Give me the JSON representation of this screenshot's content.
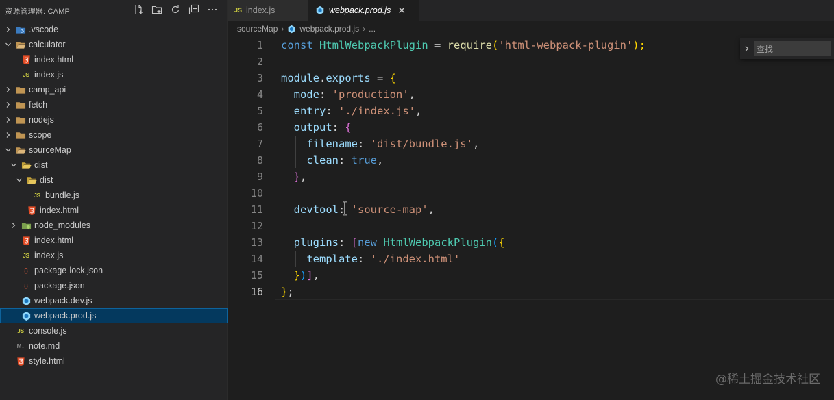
{
  "sidebar": {
    "title": "资源管理器: CAMP",
    "actions": [
      "new-file-icon",
      "new-folder-icon",
      "refresh-icon",
      "collapse-all-icon",
      "more-icon"
    ],
    "items": [
      {
        "label": ".vscode",
        "level": 0,
        "type": "folder",
        "expanded": false,
        "icon": "vscode-folder-icon"
      },
      {
        "label": "calculator",
        "level": 0,
        "type": "folder",
        "expanded": true,
        "icon": "folder-open-icon"
      },
      {
        "label": "index.html",
        "level": 1,
        "type": "file",
        "icon": "html-icon"
      },
      {
        "label": "index.js",
        "level": 1,
        "type": "file",
        "icon": "js-icon"
      },
      {
        "label": "camp_api",
        "level": 0,
        "type": "folder",
        "expanded": false,
        "icon": "folder-icon"
      },
      {
        "label": "fetch",
        "level": 0,
        "type": "folder",
        "expanded": false,
        "icon": "folder-icon"
      },
      {
        "label": "nodejs",
        "level": 0,
        "type": "folder",
        "expanded": false,
        "icon": "folder-icon"
      },
      {
        "label": "scope",
        "level": 0,
        "type": "folder",
        "expanded": false,
        "icon": "folder-icon"
      },
      {
        "label": "sourceMap",
        "level": 0,
        "type": "folder",
        "expanded": true,
        "icon": "folder-open-icon"
      },
      {
        "label": "dist",
        "level": 1,
        "type": "folder",
        "expanded": true,
        "icon": "dist-folder-icon"
      },
      {
        "label": "dist",
        "level": 2,
        "type": "folder",
        "expanded": true,
        "icon": "dist-folder-icon"
      },
      {
        "label": "bundle.js",
        "level": 3,
        "type": "file",
        "icon": "js-icon"
      },
      {
        "label": "index.html",
        "level": 2,
        "type": "file",
        "icon": "html-icon"
      },
      {
        "label": "node_modules",
        "level": 1,
        "type": "folder",
        "expanded": false,
        "icon": "node-folder-icon"
      },
      {
        "label": "index.html",
        "level": 1,
        "type": "file",
        "icon": "html-icon"
      },
      {
        "label": "index.js",
        "level": 1,
        "type": "file",
        "icon": "js-icon"
      },
      {
        "label": "package-lock.json",
        "level": 1,
        "type": "file",
        "icon": "json-icon"
      },
      {
        "label": "package.json",
        "level": 1,
        "type": "file",
        "icon": "json-icon"
      },
      {
        "label": "webpack.dev.js",
        "level": 1,
        "type": "file",
        "icon": "webpack-icon"
      },
      {
        "label": "webpack.prod.js",
        "level": 1,
        "type": "file",
        "icon": "webpack-icon",
        "selected": true
      },
      {
        "label": "console.js",
        "level": 0,
        "type": "file",
        "icon": "js-icon"
      },
      {
        "label": "note.md",
        "level": 0,
        "type": "file",
        "icon": "markdown-icon"
      },
      {
        "label": "style.html",
        "level": 0,
        "type": "file",
        "icon": "html-icon"
      }
    ]
  },
  "tabs": [
    {
      "label": "index.js",
      "icon": "js-icon",
      "active": false,
      "js_badge": "JS"
    },
    {
      "label": "webpack.prod.js",
      "icon": "webpack-icon",
      "active": true,
      "close": "✕"
    }
  ],
  "breadcrumb": {
    "folder": "sourceMap",
    "file": "webpack.prod.js",
    "trailing": "..."
  },
  "find_widget": {
    "placeholder": "查找"
  },
  "editor": {
    "current_line": 16,
    "line_numbers": [
      "1",
      "2",
      "3",
      "4",
      "5",
      "6",
      "7",
      "8",
      "9",
      "10",
      "11",
      "12",
      "13",
      "14",
      "15",
      "16"
    ]
  },
  "code": {
    "l1": {
      "kw": "const",
      "cls": "HtmlWebpackPlugin",
      "eq": " = ",
      "fn": "require",
      "p1": "(",
      "str": "'html-webpack-plugin'",
      "p2": ");"
    },
    "l3": {
      "v1": "module",
      "dot": ".",
      "v2": "exports",
      "eq": " = ",
      "b": "{"
    },
    "l4": {
      "prop": "mode",
      "colon": ": ",
      "str": "'production'",
      "comma": ","
    },
    "l5": {
      "prop": "entry",
      "colon": ": ",
      "str": "'./index.js'",
      "comma": ","
    },
    "l6": {
      "prop": "output",
      "colon": ": ",
      "b": "{"
    },
    "l7": {
      "prop": "filename",
      "colon": ": ",
      "str": "'dist/bundle.js'",
      "comma": ","
    },
    "l8": {
      "prop": "clean",
      "colon": ": ",
      "kw": "true",
      "comma": ","
    },
    "l9": {
      "b": "}",
      "comma": ","
    },
    "l11": {
      "prop": "devtool",
      "colon": ": ",
      "str": "'source-map'",
      "comma": ","
    },
    "l13": {
      "prop": "plugins",
      "colon": ": ",
      "b1": "[",
      "kw": "new ",
      "cls": "HtmlWebpackPlugin",
      "b2": "(",
      "b3": "{"
    },
    "l14": {
      "prop": "template",
      "colon": ": ",
      "str": "'./index.html'"
    },
    "l15": {
      "b3": "}",
      "b2": ")",
      "b1": "]",
      "comma": ","
    },
    "l16": {
      "b": "}",
      "semi": ";"
    }
  },
  "watermark": "@稀土掘金技术社区",
  "colors": {
    "sidebar_bg": "#252526",
    "editor_bg": "#1e1e1e",
    "selection_bg": "#04395e",
    "keyword": "#569cd6",
    "class": "#4ec9b0",
    "string": "#ce9178",
    "property": "#9cdcfe"
  }
}
